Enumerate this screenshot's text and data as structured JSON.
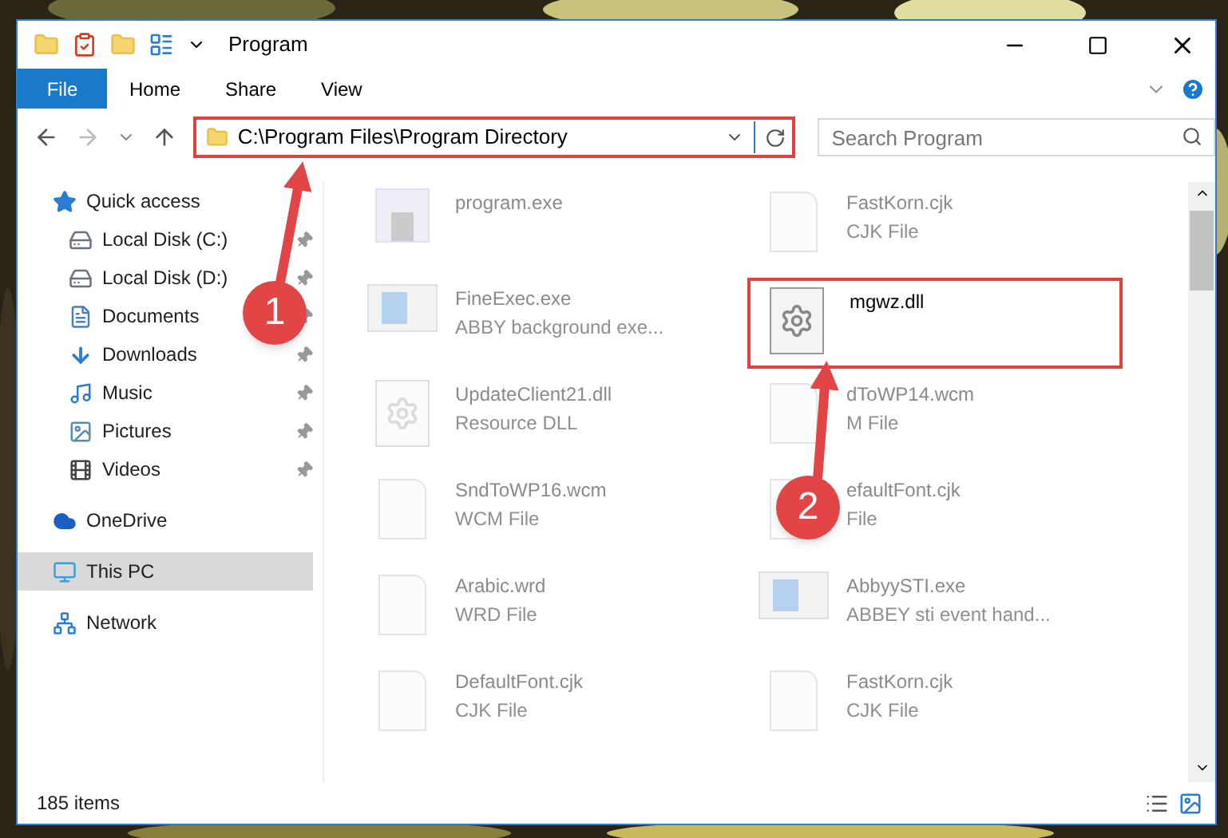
{
  "window": {
    "title": "Program"
  },
  "ribbon_tabs": [
    {
      "label": "File",
      "selected": true
    },
    {
      "label": "Home",
      "selected": false
    },
    {
      "label": "Share",
      "selected": false
    },
    {
      "label": "View",
      "selected": false
    }
  ],
  "address_bar": {
    "value": "C:\\Program Files\\Program Directory",
    "highlighted": true
  },
  "search": {
    "placeholder": "Search Program"
  },
  "sidebar": {
    "items": [
      {
        "label": "Quick access",
        "kind": "star",
        "selected": false,
        "children": [
          {
            "label": "Local Disk (C:)",
            "kind": "system-drive",
            "pinned": true,
            "selected": false
          },
          {
            "label": "Local Disk (D:)",
            "kind": "drive",
            "pinned": true,
            "selected": false
          },
          {
            "label": "Documents",
            "kind": "documents",
            "pinned": true,
            "selected": false
          },
          {
            "label": "Downloads",
            "kind": "downloads",
            "pinned": true,
            "selected": false
          },
          {
            "label": "Music",
            "kind": "music",
            "pinned": true,
            "selected": false
          },
          {
            "label": "Pictures",
            "kind": "pictures",
            "pinned": true,
            "selected": false
          },
          {
            "label": "Videos",
            "kind": "videos",
            "pinned": true,
            "selected": false
          }
        ]
      },
      {
        "label": "OneDrive",
        "kind": "cloud",
        "selected": false
      },
      {
        "label": "This PC",
        "kind": "pc",
        "selected": true
      },
      {
        "label": "Network",
        "kind": "network",
        "selected": false
      }
    ]
  },
  "files": [
    {
      "name": "program.exe",
      "kind": "app",
      "highlighted": false
    },
    {
      "name": "FastKorn.cjk",
      "type": "CJK File",
      "kind": "file",
      "highlighted": false
    },
    {
      "name": "FineExec.exe",
      "type": "ABBY background exe...",
      "kind": "window",
      "highlighted": false
    },
    {
      "name": "mgwz.dll",
      "kind": "dll",
      "highlighted": true
    },
    {
      "name": "UpdateClient21.dll",
      "type": "Resource DLL",
      "kind": "dll",
      "highlighted": false
    },
    {
      "name": "dToWP14.wcm",
      "type": "M File",
      "kind": "file",
      "highlighted": false
    },
    {
      "name": "SndToWP16.wcm",
      "type": "WCM File",
      "kind": "file",
      "highlighted": false
    },
    {
      "name": "efaultFont.cjk",
      "type": "File",
      "kind": "file",
      "highlighted": false
    },
    {
      "name": "Arabic.wrd",
      "type": "WRD File",
      "kind": "file",
      "highlighted": false
    },
    {
      "name": "AbbyySTI.exe",
      "type": "ABBEY sti event hand...",
      "kind": "window",
      "highlighted": false
    },
    {
      "name": "DefaultFont.cjk",
      "type": "CJK File",
      "kind": "file",
      "highlighted": false
    },
    {
      "name": "FastKorn.cjk",
      "type": "CJK File",
      "kind": "file",
      "highlighted": false
    }
  ],
  "callouts": [
    {
      "number": "1"
    },
    {
      "number": "2"
    }
  ],
  "status_bar": {
    "count": "185 items"
  }
}
